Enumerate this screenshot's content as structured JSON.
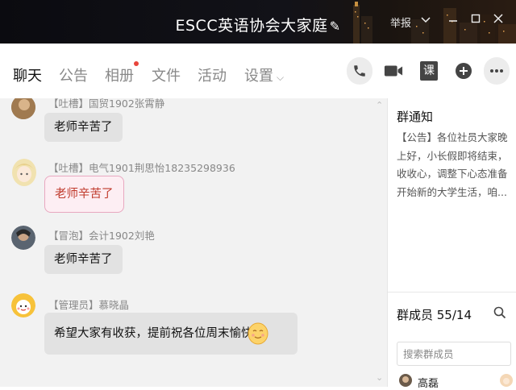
{
  "window": {
    "title": "ESCC英语协会大家庭",
    "title_icon": "pen-icon",
    "report_label": "举报",
    "controls": [
      "chevron-down-icon",
      "minimize-icon",
      "maximize-icon",
      "close-icon"
    ]
  },
  "tabs": [
    {
      "label": "聊天",
      "active": true
    },
    {
      "label": "公告",
      "active": false
    },
    {
      "label": "相册",
      "active": false,
      "badge": true
    },
    {
      "label": "文件",
      "active": false
    },
    {
      "label": "活动",
      "active": false
    },
    {
      "label": "设置",
      "active": false,
      "dropdown": true
    }
  ],
  "toolbar": {
    "call_icon": "phone-icon",
    "video_icon": "video-call-icon",
    "lesson_label": "课",
    "add_icon": "plus-icon",
    "more_icon": "more-icon"
  },
  "messages": [
    {
      "sender": "【吐槽】国贸1902张霄静",
      "text": "老师辛苦了"
    },
    {
      "sender": "【吐槽】电气1901荆思怡18235298936",
      "text": "老师辛苦了"
    },
    {
      "sender": "【冒泡】会计1902刘艳",
      "text": "老师辛苦了"
    },
    {
      "sender": "【管理员】慕晓晶",
      "text": "希望大家有收获，提前祝各位周末愉快!"
    }
  ],
  "side": {
    "notice_title": "群通知",
    "notice_tag": "【公告】",
    "notice_text": "各位社员大家晚上好，小长假即将结束，收收心，调整下心态准备开始新的大学生活，咱...",
    "members_label": "群成员 55/14",
    "search_placeholder": "搜索群成员",
    "first_member": "高磊"
  },
  "colors": {
    "titlebar": "#0b0b10",
    "chat_bg": "#f2f2f2",
    "bubble": "#e2e2e2",
    "pink_bubble_text": "#c0392b",
    "badge": "#e8453c"
  }
}
